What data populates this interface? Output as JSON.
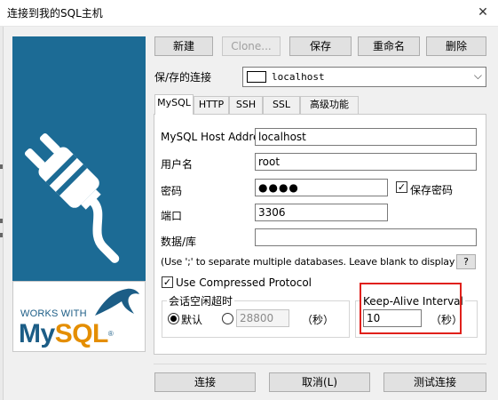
{
  "window": {
    "title": "连接到我的SQL主机",
    "close_glyph": "✕"
  },
  "logo": {
    "works_with": "WORKS WITH",
    "brand_my": "My",
    "brand_sql": "SQL",
    "registered": "®"
  },
  "toolbar": {
    "new": "新建",
    "clone": "Clone...",
    "save": "保存",
    "rename": "重命名",
    "delete": "删除"
  },
  "saved_connection": {
    "label": "保/存的连接",
    "value": "localhost"
  },
  "tabs": [
    "MySQL",
    "HTTP",
    "SSH",
    "SSL",
    "高级功能"
  ],
  "mysql_tab": {
    "host_label": "MySQL Host Address",
    "host_value": "localhost",
    "user_label": "用户名",
    "user_value": "root",
    "password_label": "密码",
    "password_value": "●●●●",
    "save_password_label": "保存密码",
    "port_label": "端口",
    "port_value": "3306",
    "database_label": "数据/库",
    "database_value": "",
    "database_hint": "(Use ';' to separate multiple databases. Leave blank to display all)",
    "help_button": "?",
    "compressed_label": "Use Compressed Protocol",
    "session_timeout": {
      "legend": "会话空闲超时",
      "default_label": "默认",
      "custom_value": "28800",
      "unit": "（秒）"
    },
    "keepalive": {
      "legend": "Keep-Alive Interval",
      "value": "10",
      "unit": "（秒）"
    }
  },
  "footer": {
    "connect": "连接",
    "cancel": "取消(L)",
    "test": "测试连接"
  },
  "icons": {
    "checkbox_checked": "✓",
    "dropdown": "⌵"
  },
  "colors": {
    "logo_blue": "#1c6b95",
    "mysql_blue": "#1c5d86",
    "mysql_orange": "#e48e00",
    "highlight_red": "#e0201a"
  }
}
